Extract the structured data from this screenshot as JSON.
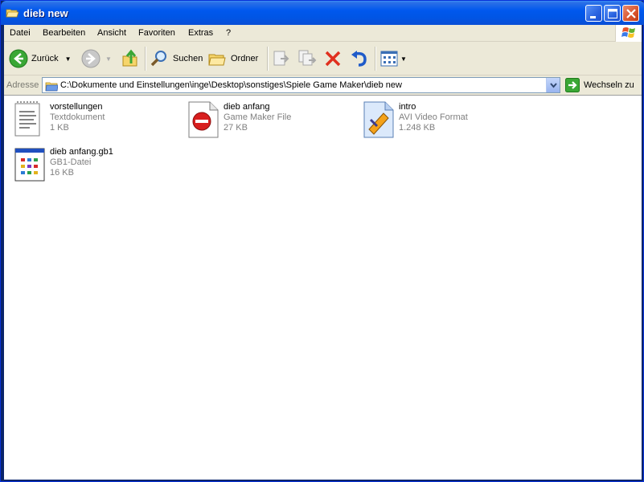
{
  "window": {
    "title": "dieb new"
  },
  "menu": {
    "items": [
      "Datei",
      "Bearbeiten",
      "Ansicht",
      "Favoriten",
      "Extras",
      "?"
    ]
  },
  "toolbar": {
    "back_label": "Zurück",
    "search_label": "Suchen",
    "folders_label": "Ordner"
  },
  "address": {
    "label": "Adresse",
    "path": "C:\\Dokumente und Einstellungen\\inge\\Desktop\\sonstiges\\Spiele Game Maker\\dieb new",
    "go_label": "Wechseln zu"
  },
  "files": [
    {
      "name": "vorstellungen",
      "type": "Textdokument",
      "size": "1 KB",
      "icon": "text-document-icon"
    },
    {
      "name": "dieb anfang",
      "type": "Game Maker File",
      "size": "27 KB",
      "icon": "game-maker-file-icon"
    },
    {
      "name": "intro",
      "type": "AVI Video Format",
      "size": "1.248 KB",
      "icon": "avi-video-icon"
    },
    {
      "name": "dieb anfang.gb1",
      "type": "GB1-Datei",
      "size": "16 KB",
      "icon": "gb1-file-icon"
    }
  ],
  "colors": {
    "titlebar": "#0055e5",
    "chrome": "#ece9d8",
    "close_button": "#d9542e"
  }
}
